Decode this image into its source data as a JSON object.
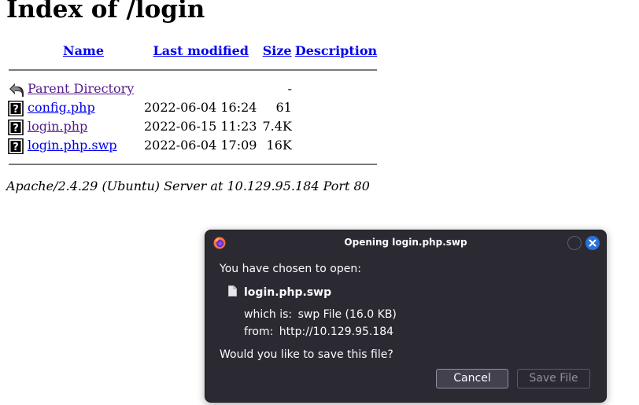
{
  "page": {
    "heading": "Index of /login",
    "columns": {
      "name": "Name",
      "last_modified": "Last modified",
      "size": "Size",
      "description": "Description"
    },
    "parent": {
      "name": "Parent Directory",
      "size": "-"
    },
    "files": [
      {
        "name": "config.php",
        "modified": "2022-06-04 16:24",
        "size": "61"
      },
      {
        "name": "login.php",
        "modified": "2022-06-15 11:23",
        "size": "7.4K"
      },
      {
        "name": "login.php.swp",
        "modified": "2022-06-04 17:09",
        "size": "16K"
      }
    ],
    "footer": "Apache/2.4.29 (Ubuntu) Server at 10.129.95.184 Port 80"
  },
  "dialog": {
    "title": "Opening login.php.swp",
    "intro": "You have chosen to open:",
    "filename": "login.php.swp",
    "which_is_label": "which is:",
    "which_is_value": "swp File (16.0 KB)",
    "from_label": "from:",
    "from_value": "http://10.129.95.184",
    "question": "Would you like to save this file?",
    "cancel_label": "Cancel",
    "save_label": "Save File"
  },
  "colors": {
    "link": "#0000ee",
    "visited_link": "#551a8b",
    "dialog_bg": "#2b2a33",
    "close_button": "#2a72d9"
  },
  "icons": {
    "parent": "back-arrow-icon",
    "file": "unknown-file-icon",
    "dialog_file": "document-icon",
    "browser": "firefox-icon"
  }
}
